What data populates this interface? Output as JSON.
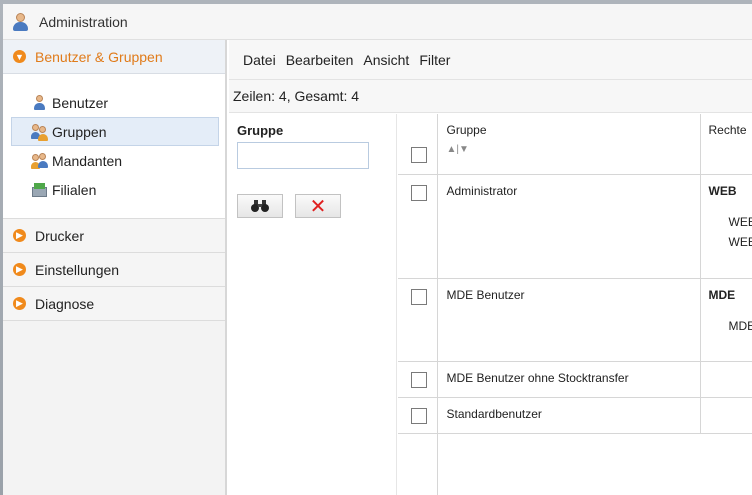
{
  "window": {
    "title": "Administration"
  },
  "sidebar": {
    "sections": [
      {
        "label": "Benutzer & Gruppen",
        "active": true
      },
      {
        "label": "Drucker"
      },
      {
        "label": "Einstellungen"
      },
      {
        "label": "Diagnose"
      }
    ],
    "items": [
      {
        "label": "Benutzer",
        "icon": "user-icon"
      },
      {
        "label": "Gruppen",
        "icon": "group-icon",
        "selected": true
      },
      {
        "label": "Mandanten",
        "icon": "clients-icon"
      },
      {
        "label": "Filialen",
        "icon": "branches-icon"
      }
    ]
  },
  "menu": {
    "items": [
      "Datei",
      "Bearbeiten",
      "Ansicht",
      "Filter"
    ]
  },
  "status": {
    "rows": "Zeilen: 4, Gesamt: 4"
  },
  "filter": {
    "label": "Gruppe",
    "value": ""
  },
  "grid": {
    "columns": [
      "Gruppe",
      "Rechte"
    ],
    "sort_indicator": "▲|▼",
    "rows": [
      {
        "gruppe": "Administrator",
        "rechte": "WEB",
        "sub1": "WEB",
        "sub2": "WEB"
      },
      {
        "gruppe": "MDE Benutzer",
        "rechte": "MDE",
        "sub1": "MDE"
      },
      {
        "gruppe": "MDE Benutzer ohne Stocktransfer",
        "rechte": ""
      },
      {
        "gruppe": "Standardbenutzer",
        "rechte": ""
      }
    ]
  },
  "colors": {
    "accent": "#f08a1c",
    "selection": "#e4edf8"
  }
}
